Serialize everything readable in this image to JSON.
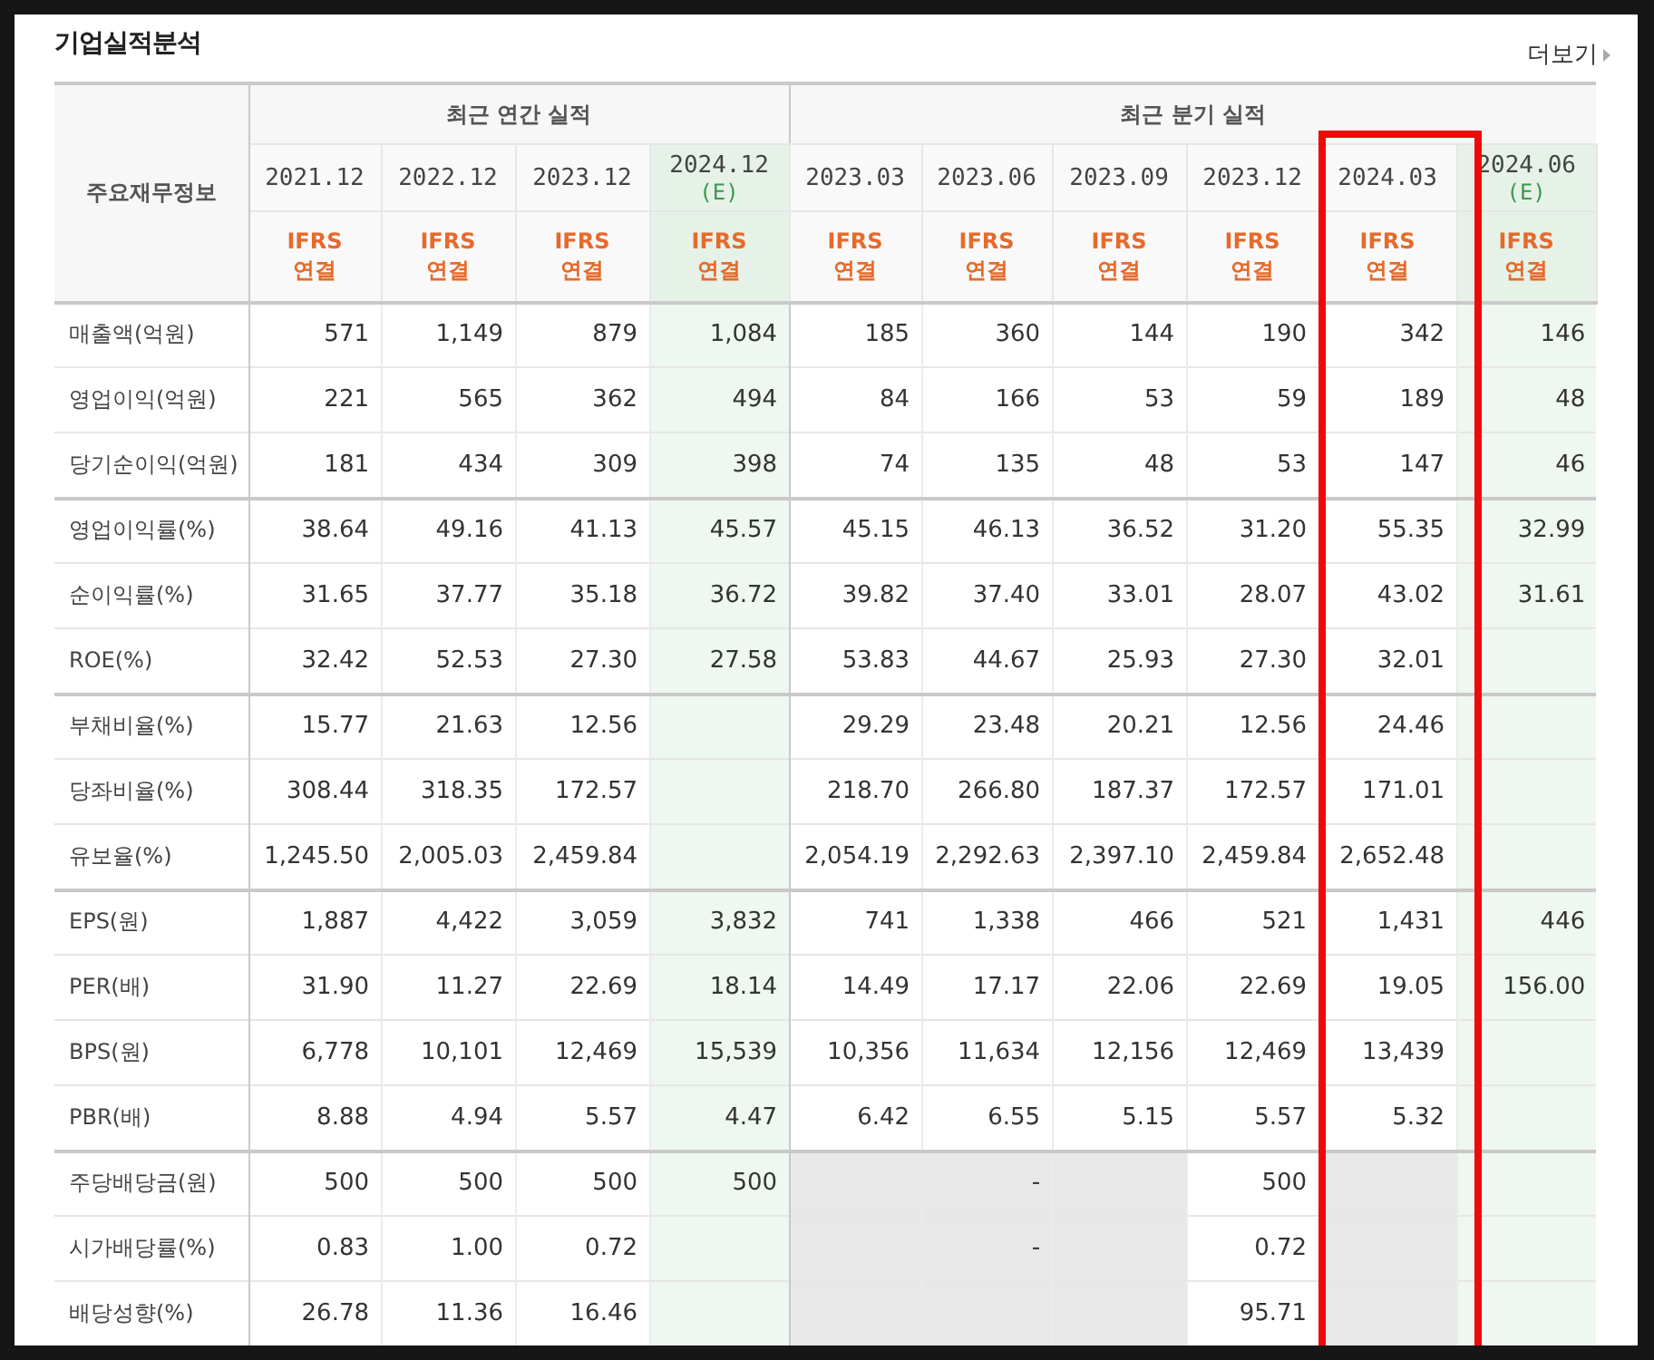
{
  "title": "기업실적분석",
  "more_link": "더보기",
  "table": {
    "corner": "주요재무정보",
    "groups": [
      {
        "label": "최근 연간 실적",
        "periods": [
          {
            "label": "2021.12",
            "basis": "IFRS 연결",
            "estimate": false,
            "highlighted": false
          },
          {
            "label": "2022.12",
            "basis": "IFRS 연결",
            "estimate": false,
            "highlighted": false
          },
          {
            "label": "2023.12",
            "basis": "IFRS 연결",
            "estimate": false,
            "highlighted": false
          },
          {
            "label": "2024.12",
            "note": "(E)",
            "basis": "IFRS 연결",
            "estimate": true,
            "highlighted": false
          }
        ]
      },
      {
        "label": "최근 분기 실적",
        "periods": [
          {
            "label": "2023.03",
            "basis": "IFRS 연결",
            "estimate": false,
            "highlighted": false
          },
          {
            "label": "2023.06",
            "basis": "IFRS 연결",
            "estimate": false,
            "highlighted": false
          },
          {
            "label": "2023.09",
            "basis": "IFRS 연결",
            "estimate": false,
            "highlighted": false
          },
          {
            "label": "2023.12",
            "basis": "IFRS 연결",
            "estimate": false,
            "highlighted": false
          },
          {
            "label": "2024.03",
            "basis": "IFRS 연결",
            "estimate": false,
            "highlighted": true
          },
          {
            "label": "2024.06",
            "note": "(E)",
            "basis": "IFRS 연결",
            "estimate": true,
            "highlighted": false
          }
        ]
      }
    ],
    "row_groups": [
      {
        "rows": [
          {
            "label": "매출액(억원)",
            "cells": [
              "571",
              "1,149",
              "879",
              "1,084",
              "185",
              "360",
              "144",
              "190",
              "342",
              "146"
            ]
          },
          {
            "label": "영업이익(억원)",
            "cells": [
              "221",
              "565",
              "362",
              "494",
              "84",
              "166",
              "53",
              "59",
              "189",
              "48"
            ]
          },
          {
            "label": "당기순이익(억원)",
            "cells": [
              "181",
              "434",
              "309",
              "398",
              "74",
              "135",
              "48",
              "53",
              "147",
              "46"
            ]
          }
        ]
      },
      {
        "rows": [
          {
            "label": "영업이익률(%)",
            "cells": [
              "38.64",
              "49.16",
              "41.13",
              "45.57",
              "45.15",
              "46.13",
              "36.52",
              "31.20",
              "55.35",
              "32.99"
            ]
          },
          {
            "label": "순이익률(%)",
            "cells": [
              "31.65",
              "37.77",
              "35.18",
              "36.72",
              "39.82",
              "37.40",
              "33.01",
              "28.07",
              "43.02",
              "31.61"
            ]
          },
          {
            "label": "ROE(%)",
            "cells": [
              "32.42",
              "52.53",
              "27.30",
              "27.58",
              "53.83",
              "44.67",
              "25.93",
              "27.30",
              "32.01",
              null
            ]
          }
        ]
      },
      {
        "rows": [
          {
            "label": "부채비율(%)",
            "cells": [
              "15.77",
              "21.63",
              "12.56",
              null,
              "29.29",
              "23.48",
              "20.21",
              "12.56",
              "24.46",
              null
            ]
          },
          {
            "label": "당좌비율(%)",
            "cells": [
              "308.44",
              "318.35",
              "172.57",
              null,
              "218.70",
              "266.80",
              "187.37",
              "172.57",
              "171.01",
              null
            ]
          },
          {
            "label": "유보율(%)",
            "cells": [
              "1,245.50",
              "2,005.03",
              "2,459.84",
              null,
              "2,054.19",
              "2,292.63",
              "2,397.10",
              "2,459.84",
              "2,652.48",
              null
            ]
          }
        ]
      },
      {
        "rows": [
          {
            "label": "EPS(원)",
            "cells": [
              "1,887",
              "4,422",
              "3,059",
              "3,832",
              "741",
              "1,338",
              "466",
              "521",
              "1,431",
              "446"
            ]
          },
          {
            "label": "PER(배)",
            "cells": [
              "31.90",
              "11.27",
              "22.69",
              "18.14",
              "14.49",
              "17.17",
              "22.06",
              "22.69",
              "19.05",
              "156.00"
            ]
          },
          {
            "label": "BPS(원)",
            "cells": [
              "6,778",
              "10,101",
              "12,469",
              "15,539",
              "10,356",
              "11,634",
              "12,156",
              "12,469",
              "13,439",
              null
            ]
          },
          {
            "label": "PBR(배)",
            "cells": [
              "8.88",
              "4.94",
              "5.57",
              "4.47",
              "6.42",
              "6.55",
              "5.15",
              "5.57",
              "5.32",
              null
            ]
          }
        ]
      },
      {
        "rows": [
          {
            "label": "주당배당금(원)",
            "cells": [
              "500",
              "500",
              "500",
              "500",
              {
                "shaded": true
              },
              {
                "text": "-",
                "shaded": true
              },
              {
                "shaded": true
              },
              "500",
              {
                "shaded": true
              },
              null
            ]
          },
          {
            "label": "시가배당률(%)",
            "cells": [
              "0.83",
              "1.00",
              "0.72",
              null,
              {
                "shaded": true
              },
              {
                "text": "-",
                "shaded": true
              },
              {
                "shaded": true
              },
              "0.72",
              {
                "shaded": true
              },
              null
            ]
          },
          {
            "label": "배당성향(%)",
            "cells": [
              "26.78",
              "11.36",
              "16.46",
              null,
              {
                "shaded": true
              },
              {
                "shaded": true
              },
              {
                "shaded": true
              },
              "95.71",
              {
                "shaded": true
              },
              null
            ]
          }
        ]
      }
    ]
  }
}
